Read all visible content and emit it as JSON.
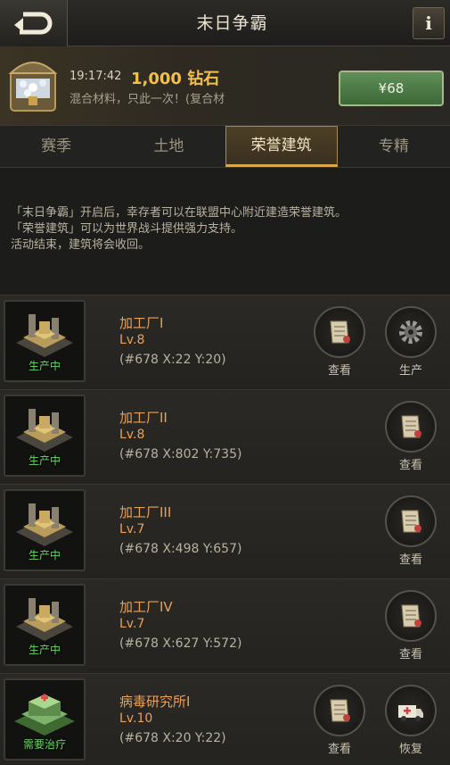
{
  "header": {
    "title": "末日争霸",
    "info_label": "i"
  },
  "promo": {
    "time": "19:17:42",
    "amount": "1,000 钻石",
    "description": "混合材料，只此一次！(复合材",
    "price": "¥68",
    "page_dots": 7,
    "active_dot": 0
  },
  "tabs": [
    {
      "label": "赛季",
      "active": false
    },
    {
      "label": "土地",
      "active": false
    },
    {
      "label": "荣誉建筑",
      "active": true
    },
    {
      "label": "专精",
      "active": false
    }
  ],
  "description": {
    "lines": [
      "「末日争霸」开启后，幸存者可以在联盟中心附近建造荣誉建筑。",
      "「荣誉建筑」可以为世界战斗提供强力支持。",
      "活动结束，建筑将会收回。"
    ]
  },
  "buildings": [
    {
      "name": "加工厂I",
      "level": "Lv.8",
      "coords": "(#678 X:22 Y:20)",
      "status": "生产中",
      "icon": "factory-icon",
      "actions": [
        {
          "label": "查看",
          "icon": "scroll-icon"
        },
        {
          "label": "生产",
          "icon": "gear-icon"
        }
      ]
    },
    {
      "name": "加工厂II",
      "level": "Lv.8",
      "coords": "(#678 X:802 Y:735)",
      "status": "生产中",
      "icon": "factory-icon",
      "actions": [
        {
          "label": "查看",
          "icon": "scroll-icon"
        }
      ]
    },
    {
      "name": "加工厂III",
      "level": "Lv.7",
      "coords": "(#678 X:498 Y:657)",
      "status": "生产中",
      "icon": "factory-icon",
      "actions": [
        {
          "label": "查看",
          "icon": "scroll-icon"
        }
      ]
    },
    {
      "name": "加工厂IV",
      "level": "Lv.7",
      "coords": "(#678 X:627 Y:572)",
      "status": "生产中",
      "icon": "factory-icon",
      "actions": [
        {
          "label": "查看",
          "icon": "scroll-icon"
        }
      ]
    },
    {
      "name": "病毒研究所I",
      "level": "Lv.10",
      "coords": "(#678 X:20 Y:22)",
      "status": "需要治疗",
      "icon": "virus-lab-icon",
      "actions": [
        {
          "label": "查看",
          "icon": "scroll-icon"
        },
        {
          "label": "恢复",
          "icon": "ambulance-icon"
        }
      ]
    }
  ],
  "colors": {
    "accent_gold": "#e7b24a",
    "name_orange": "#e8a05a",
    "status_green": "#6ed86a",
    "price_green": "#4d7a46"
  }
}
